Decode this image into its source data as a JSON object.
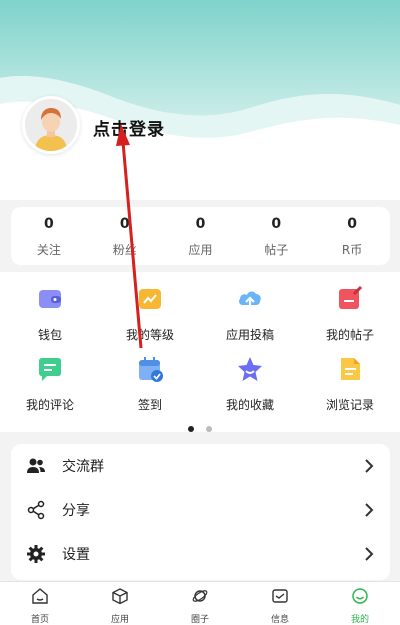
{
  "header": {
    "login_text": "点击登录"
  },
  "stats": [
    {
      "value": "0",
      "label": "关注"
    },
    {
      "value": "0",
      "label": "粉丝"
    },
    {
      "value": "0",
      "label": "应用"
    },
    {
      "value": "0",
      "label": "帖子"
    },
    {
      "value": "0",
      "label": "R币"
    }
  ],
  "grid": [
    {
      "label": "钱包",
      "icon": "wallet-icon"
    },
    {
      "label": "我的等级",
      "icon": "level-icon"
    },
    {
      "label": "应用投稿",
      "icon": "cloud-upload-icon"
    },
    {
      "label": "我的帖子",
      "icon": "post-icon"
    },
    {
      "label": "我的评论",
      "icon": "comment-icon"
    },
    {
      "label": "签到",
      "icon": "calendar-check-icon"
    },
    {
      "label": "我的收藏",
      "icon": "star-icon"
    },
    {
      "label": "浏览记录",
      "icon": "history-icon"
    }
  ],
  "menu": [
    {
      "label": "交流群",
      "icon": "group-icon"
    },
    {
      "label": "分享",
      "icon": "share-icon"
    },
    {
      "label": "设置",
      "icon": "gear-icon"
    }
  ],
  "tabs": [
    {
      "label": "首页",
      "icon": "home-icon"
    },
    {
      "label": "应用",
      "icon": "box-icon"
    },
    {
      "label": "圈子",
      "icon": "planet-icon"
    },
    {
      "label": "信息",
      "icon": "message-icon"
    },
    {
      "label": "我的",
      "icon": "smile-icon"
    }
  ],
  "colors": {
    "header_teal": "#8fd8d1",
    "accent_green": "#2eb84d",
    "annotation_red": "#d61f1f"
  }
}
